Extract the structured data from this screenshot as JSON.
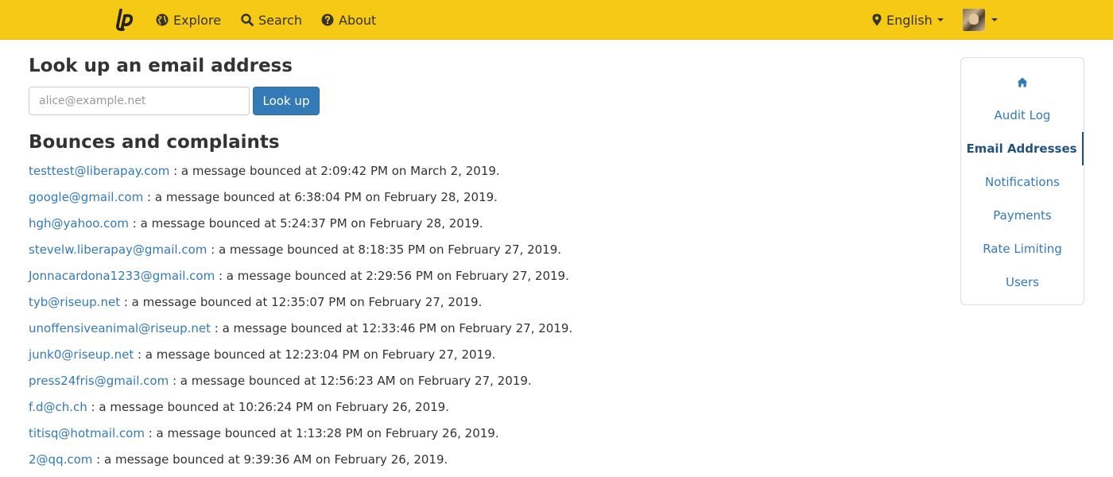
{
  "navbar": {
    "logo": "lp",
    "items": [
      {
        "label": "Explore",
        "icon": "globe-icon"
      },
      {
        "label": "Search",
        "icon": "search-icon"
      },
      {
        "label": "About",
        "icon": "question-circle-icon"
      }
    ],
    "language": {
      "label": "English",
      "icon": "map-marker-icon"
    },
    "user_menu": {
      "icon": "avatar"
    }
  },
  "lookup": {
    "title": "Look up an email address",
    "placeholder": "alice@example.net",
    "value": "",
    "button_label": "Look up"
  },
  "bounces": {
    "title": "Bounces and complaints",
    "items": [
      {
        "email": "testtest@liberapay.com",
        "text": ": a message bounced at 2:09:42 PM on March 2, 2019."
      },
      {
        "email": "google@gmail.com",
        "text": ": a message bounced at 6:38:04 PM on February 28, 2019."
      },
      {
        "email": "hgh@yahoo.com",
        "text": ": a message bounced at 5:24:37 PM on February 28, 2019."
      },
      {
        "email": "stevelw.liberapay@gmail.com",
        "text": ": a message bounced at 8:18:35 PM on February 27, 2019."
      },
      {
        "email": "Jonnacardona1233@gmail.com",
        "text": ": a message bounced at 2:29:56 PM on February 27, 2019."
      },
      {
        "email": "tyb@riseup.net",
        "text": ": a message bounced at 12:35:07 PM on February 27, 2019."
      },
      {
        "email": "unoffensiveanimal@riseup.net",
        "text": ": a message bounced at 12:33:46 PM on February 27, 2019."
      },
      {
        "email": "junk0@riseup.net",
        "text": ": a message bounced at 12:23:04 PM on February 27, 2019."
      },
      {
        "email": "press24fris@gmail.com",
        "text": ": a message bounced at 12:56:23 AM on February 27, 2019."
      },
      {
        "email": "f.d@ch.ch",
        "text": ": a message bounced at 10:26:24 PM on February 26, 2019."
      },
      {
        "email": "titisq@hotmail.com",
        "text": ": a message bounced at 1:13:28 PM on February 26, 2019."
      },
      {
        "email": "2@qq.com",
        "text": ": a message bounced at 9:39:36 AM on February 26, 2019."
      }
    ]
  },
  "sidebar": {
    "home_icon": "home-icon",
    "items": [
      {
        "label": "Audit Log",
        "active": false
      },
      {
        "label": "Email Addresses",
        "active": true
      },
      {
        "label": "Notifications",
        "active": false
      },
      {
        "label": "Payments",
        "active": false
      },
      {
        "label": "Rate Limiting",
        "active": false
      },
      {
        "label": "Users",
        "active": false
      }
    ]
  },
  "colors": {
    "navbar_bg": "#f6c915",
    "link": "#337ab7",
    "button_bg": "#337ab7",
    "active_sidebar": "#23527c"
  }
}
